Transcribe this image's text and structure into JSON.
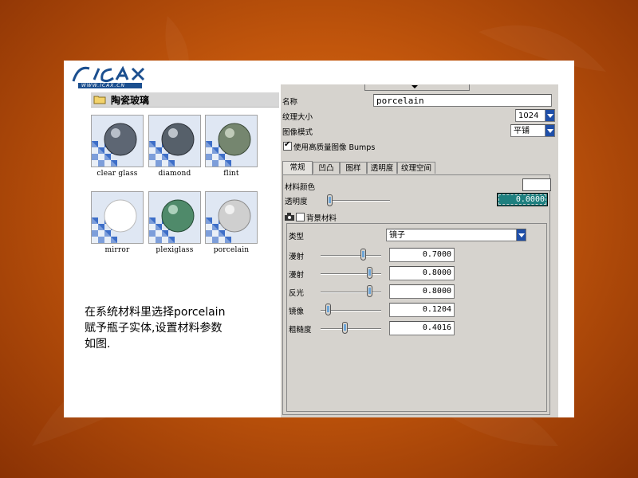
{
  "logo": {
    "text": "ICAX",
    "subtext": "WWW.ICAX.CN"
  },
  "library": {
    "folder_label": "陶瓷玻璃",
    "materials": [
      {
        "label": "clear glass"
      },
      {
        "label": "diamond"
      },
      {
        "label": "flint"
      },
      {
        "label": "mirror"
      },
      {
        "label": "plexiglass"
      },
      {
        "label": "porcelain"
      }
    ]
  },
  "caption": {
    "line1": "在系统材料里选择porcelain",
    "line2": "赋予瓶子实体,设置材料参数",
    "line3": "如图."
  },
  "dialog": {
    "name_label": "名称",
    "name_value": "porcelain",
    "texture_size_label": "纹理大小",
    "texture_size_value": "1024",
    "image_mode_label": "图像模式",
    "image_mode_value": "平铺",
    "hq_bumps_label": "使用高质量图像 Bumps",
    "hq_bumps_checked": true,
    "tabs": [
      "常规",
      "凹凸",
      "图样",
      "透明度",
      "纹理空间"
    ],
    "active_tab": "常规",
    "material_color_label": "材料颜色",
    "transparency_label": "透明度",
    "transparency_value": "0.0000",
    "transparency_level": 0.0,
    "background_material_label": "背景材料",
    "type_label": "类型",
    "type_value": "镜子",
    "params": [
      {
        "label": "漫射",
        "value": "0.7000",
        "level": 0.7
      },
      {
        "label": "漫射",
        "value": "0.8000",
        "level": 0.8
      },
      {
        "label": "反光",
        "value": "0.8000",
        "level": 0.8
      },
      {
        "label": "镜像",
        "value": "0.1204",
        "level": 0.12
      },
      {
        "label": "粗糙度",
        "value": "0.4016",
        "level": 0.4
      }
    ]
  },
  "colors": {
    "background": "#c2560c",
    "logo_blue": "#1b4f8f",
    "teal_field": "#1e7f7f"
  }
}
